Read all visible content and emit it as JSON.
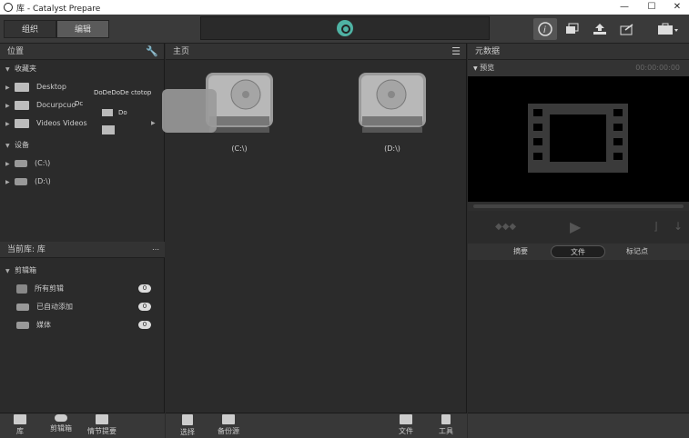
{
  "window": {
    "title": "库 - Catalyst Prepare"
  },
  "toolbar": {
    "tabs": [
      "组织",
      "编辑"
    ],
    "active_tab": "编辑",
    "accent": "#4fb3a4"
  },
  "left_panel": {
    "location_header": "位置",
    "favorites_label": "收藏夹",
    "favorites": [
      "Desktop",
      "Documents",
      "Videos"
    ],
    "favorite_display": [
      "Desktop",
      "Docurpcuo",
      "Videos  Videos"
    ],
    "drag_ghost_texts": [
      "DoDeDoDe ctotop",
      "Dc",
      "Do"
    ],
    "devices_label": "设备",
    "devices": [
      "(C:\\)",
      "(D:\\)"
    ],
    "current_lib_header": "当前库: 库",
    "bin_label": "剪辑箱",
    "bins": [
      {
        "label": "所有剪辑",
        "count": "0"
      },
      {
        "label": "已自动添加",
        "count": "0"
      },
      {
        "label": "媒体",
        "count": "0"
      }
    ]
  },
  "main_panel": {
    "header": "主页",
    "drives": [
      "(C:\\)",
      "(D:\\)"
    ]
  },
  "right_panel": {
    "header": "元数据",
    "preview_label": "预览",
    "timecode": "00:00:00:00",
    "tabs": [
      "摘要",
      "文件",
      "标记点"
    ],
    "active_tab": "文件"
  },
  "bottom_left": [
    "库",
    "剪辑箱",
    "情节提要"
  ],
  "bottom_mid": [
    "选择",
    "备份源"
  ],
  "bottom_right": [
    "文件",
    "工具"
  ]
}
